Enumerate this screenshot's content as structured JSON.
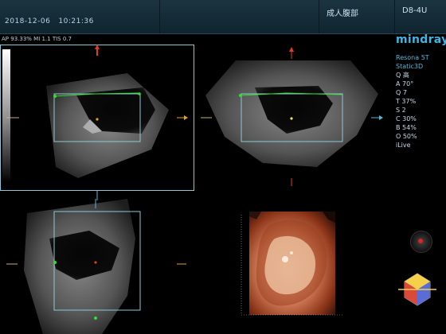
{
  "topbar": {
    "date": "2018-12-06",
    "time": "10:21:36",
    "exam_mode": "成人腹部",
    "probe": "D8-4U"
  },
  "params_bar": "AP 93.33%  MI 1.1  TIS 0.7",
  "brand": "mindray",
  "side_panel": {
    "model": "Resona 5T",
    "mode": "Static3D",
    "params": [
      "Q 高",
      "A 70°",
      "Q 7",
      "T 37%",
      "S 2",
      "C 30%",
      "B 54%",
      "O 50%"
    ],
    "ilive": "iLive"
  },
  "colors": {
    "topbar": "#1c3440",
    "accent": "#39b8e8",
    "roi_box": "#8fc7d6",
    "green_marker": "#2fe02f",
    "red_marker": "#e03a2a",
    "orange_marker": "#e8a020"
  },
  "icons": {
    "orientation_indicator": "orientation-dot-icon",
    "orientation_cube": "orientation-cube-icon"
  }
}
